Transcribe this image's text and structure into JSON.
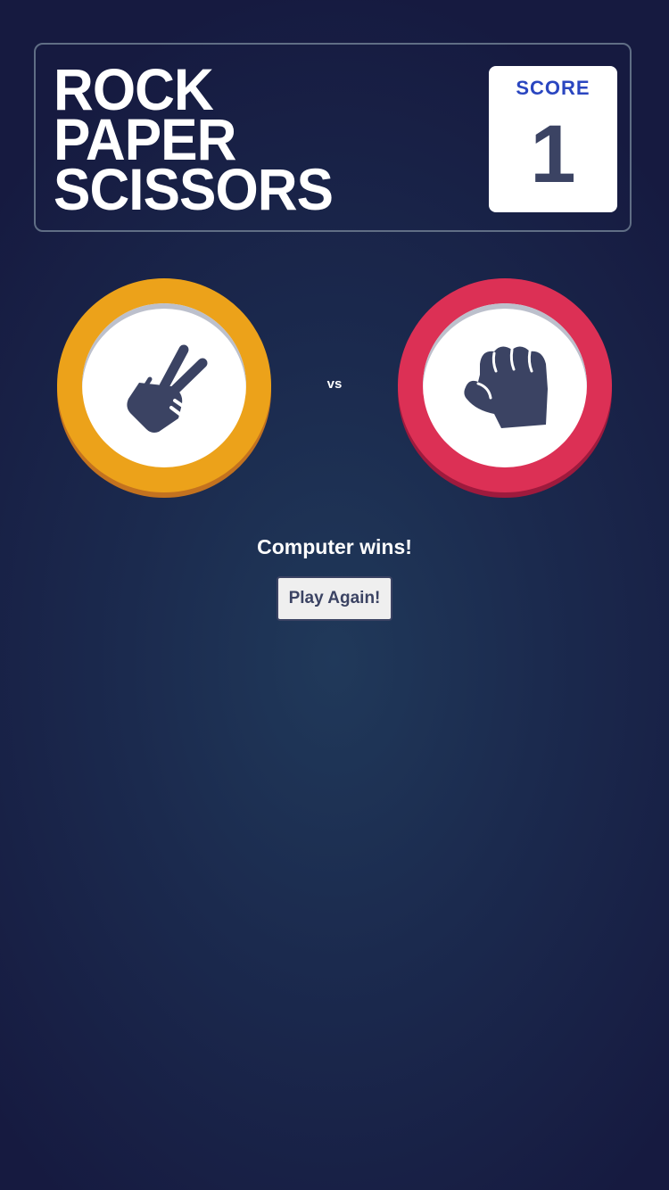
{
  "header": {
    "title_lines": [
      "ROCK",
      "PAPER",
      "SCISSORS"
    ],
    "score_label": "SCORE",
    "score_value": "1"
  },
  "game": {
    "player_pick": {
      "name": "scissors",
      "icon": "scissors-hand-icon",
      "color": "#eca21a"
    },
    "vs_label": "vs",
    "computer_pick": {
      "name": "rock",
      "icon": "rock-fist-icon",
      "color": "#dc3055"
    },
    "result_text": "Computer wins!",
    "play_again_label": "Play Again!"
  },
  "colors": {
    "background": "#1b2a4e",
    "score_label": "#2a46c0",
    "score_value": "#3b4363",
    "icon": "#3b4363"
  }
}
